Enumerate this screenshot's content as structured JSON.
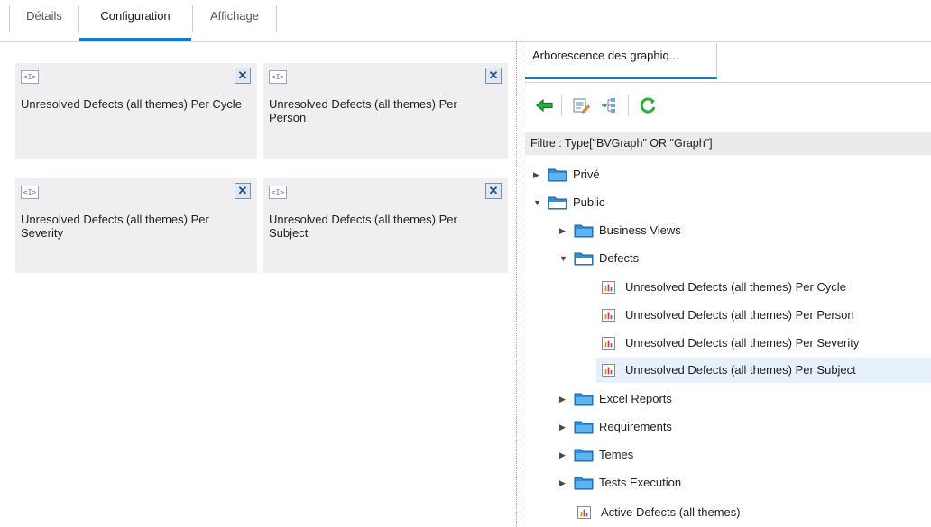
{
  "tabs": [
    {
      "label": "Détails"
    },
    {
      "label": "Configuration"
    },
    {
      "label": "Affichage"
    }
  ],
  "cards": [
    {
      "placeholder_icon": "<I>",
      "title": "Unresolved Defects (all themes) Per Cycle"
    },
    {
      "placeholder_icon": "<I>",
      "title": "Unresolved Defects (all themes) Per Person"
    },
    {
      "placeholder_icon": "<I>",
      "title": "Unresolved Defects (all themes) Per Severity"
    },
    {
      "placeholder_icon": "<I>",
      "title": "Unresolved Defects (all themes) Per Subject"
    }
  ],
  "right_panel": {
    "tab_label": "Arborescence des graphiq...",
    "toolbar_icons": [
      "back-arrow-icon",
      "edit-list-icon",
      "tree-structure-icon",
      "refresh-icon"
    ],
    "filter_text": "Filtre : Type[\"BVGraph\" OR \"Graph\"]",
    "tree": {
      "prive": "Privé",
      "public": "Public",
      "business_views": "Business Views",
      "defects": "Defects",
      "defect_graphs": [
        "Unresolved Defects (all themes) Per Cycle",
        "Unresolved Defects (all themes) Per Person",
        "Unresolved Defects (all themes) Per Severity",
        "Unresolved Defects (all themes) Per Subject"
      ],
      "excel_reports": "Excel Reports",
      "requirements": "Requirements",
      "temes": "Temes",
      "tests_execution": "Tests Execution",
      "active_defects": "Active Defects (all themes)"
    }
  },
  "colors": {
    "accent": "#0b7ed0",
    "selected_row": "#e6f1fb",
    "card_bg": "#f0eef1"
  }
}
